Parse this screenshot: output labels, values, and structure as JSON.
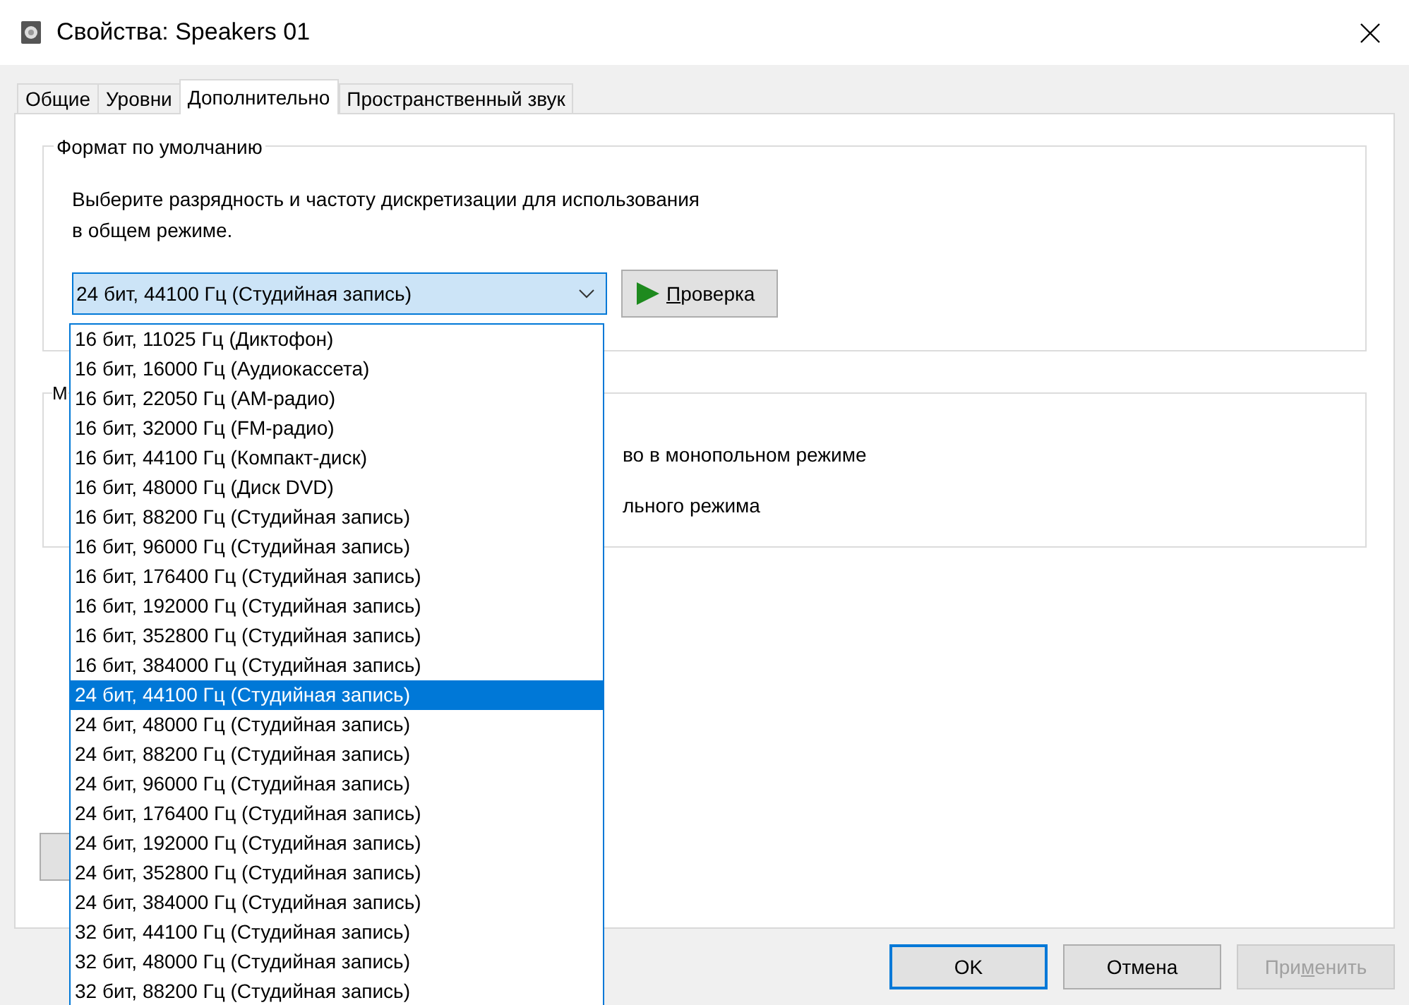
{
  "window": {
    "title": "Свойства: Speakers 01"
  },
  "tabs": [
    {
      "label": "Общие",
      "selected": false
    },
    {
      "label": "Уровни",
      "selected": false
    },
    {
      "label": "Дополнительно",
      "selected": true
    },
    {
      "label": "Пространственный звук",
      "selected": false
    }
  ],
  "default_format": {
    "title": "Формат по умолчанию",
    "description": "Выберите разрядность и частоту дискретизации для использования\nв общем режиме.",
    "combo_value": "24 бит, 44100 Гц (Студийная запись)",
    "test_button": [
      {
        "text": "П",
        "underline": true
      },
      {
        "text": "роверка",
        "underline": false
      }
    ],
    "options": [
      {
        "label": "16 бит, 11025 Гц (Диктофон)",
        "selected": false
      },
      {
        "label": "16 бит, 16000 Гц (Аудиокассета)",
        "selected": false
      },
      {
        "label": "16 бит, 22050 Гц (AM-радио)",
        "selected": false
      },
      {
        "label": "16 бит, 32000 Гц (FM-радио)",
        "selected": false
      },
      {
        "label": "16 бит, 44100 Гц (Компакт-диск)",
        "selected": false
      },
      {
        "label": "16 бит, 48000 Гц (Диск DVD)",
        "selected": false
      },
      {
        "label": "16 бит, 88200 Гц (Студийная запись)",
        "selected": false
      },
      {
        "label": "16 бит, 96000 Гц (Студийная запись)",
        "selected": false
      },
      {
        "label": "16 бит, 176400 Гц (Студийная запись)",
        "selected": false
      },
      {
        "label": "16 бит, 192000 Гц (Студийная запись)",
        "selected": false
      },
      {
        "label": "16 бит, 352800 Гц (Студийная запись)",
        "selected": false
      },
      {
        "label": "16 бит, 384000 Гц (Студийная запись)",
        "selected": false
      },
      {
        "label": "24 бит, 44100 Гц (Студийная запись)",
        "selected": true
      },
      {
        "label": "24 бит, 48000 Гц (Студийная запись)",
        "selected": false
      },
      {
        "label": "24 бит, 88200 Гц (Студийная запись)",
        "selected": false
      },
      {
        "label": "24 бит, 96000 Гц (Студийная запись)",
        "selected": false
      },
      {
        "label": "24 бит, 176400 Гц (Студийная запись)",
        "selected": false
      },
      {
        "label": "24 бит, 192000 Гц (Студийная запись)",
        "selected": false
      },
      {
        "label": "24 бит, 352800 Гц (Студийная запись)",
        "selected": false
      },
      {
        "label": "24 бит, 384000 Гц (Студийная запись)",
        "selected": false
      },
      {
        "label": "32 бит, 44100 Гц (Студийная запись)",
        "selected": false
      },
      {
        "label": "32 бит, 48000 Гц (Студийная запись)",
        "selected": false
      },
      {
        "label": "32 бит, 88200 Гц (Студийная запись)",
        "selected": false
      }
    ]
  },
  "exclusive_mode": {
    "title": "М",
    "lines": [
      "во в монопольном режиме",
      "льного режима"
    ]
  },
  "buttons": [
    {
      "parts": [
        {
          "text": "OK",
          "underline": false
        }
      ],
      "default": true,
      "disabled": false
    },
    {
      "parts": [
        {
          "text": "Отмена",
          "underline": false
        }
      ],
      "default": false,
      "disabled": false
    },
    {
      "parts": [
        {
          "text": "При",
          "underline": false
        },
        {
          "text": "м",
          "underline": true
        },
        {
          "text": "енить",
          "underline": false
        }
      ],
      "default": false,
      "disabled": true
    }
  ]
}
